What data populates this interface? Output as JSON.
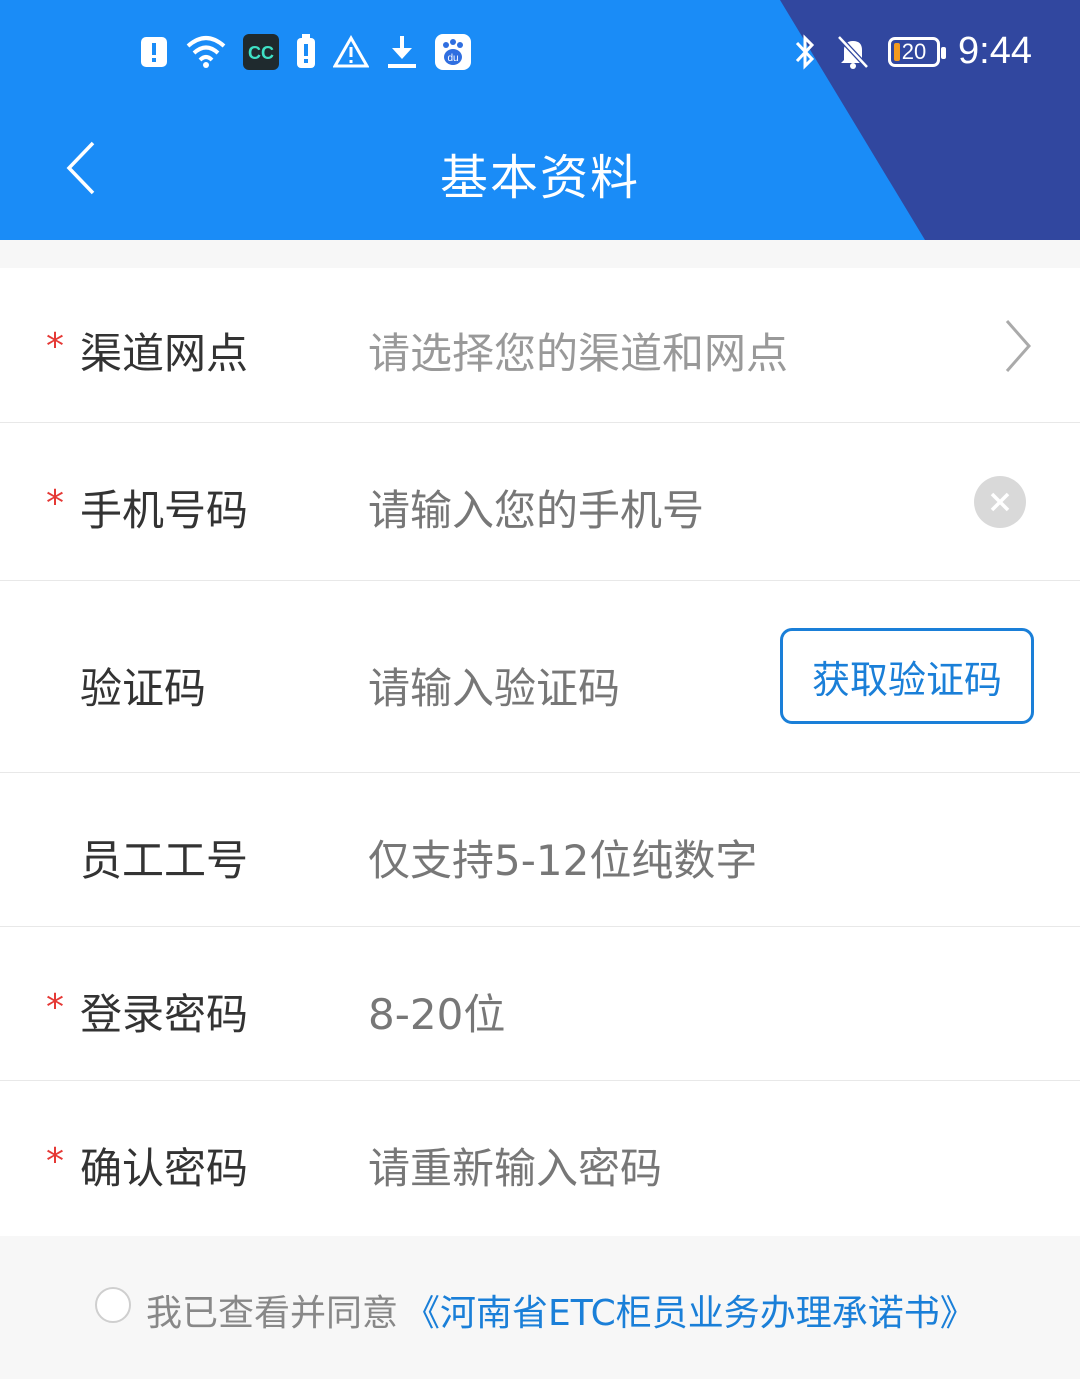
{
  "status_bar": {
    "time": "9:44",
    "battery": "20",
    "left_icons": [
      "alert-icon",
      "wifi-icon",
      "app-cc-icon",
      "sim-alert-icon",
      "warning-icon",
      "download-icon",
      "baidu-icon"
    ],
    "right_icons": [
      "bluetooth-icon",
      "mute-bell-icon",
      "battery-icon"
    ]
  },
  "header": {
    "title": "基本资料",
    "back_icon": "chevron-left-icon",
    "colors": {
      "primary": "#1a8cf7",
      "corner": "#31479f"
    }
  },
  "form": {
    "rows": [
      {
        "required": true,
        "label": "渠道网点",
        "value": "请选择您的渠道和网点",
        "trailing": "chevron-right-icon"
      },
      {
        "required": true,
        "label": "手机号码",
        "value": "请输入您的手机号",
        "trailing": "clear-icon"
      },
      {
        "required": false,
        "label": "验证码",
        "value": "请输入验证码",
        "trailing_button": "获取验证码"
      },
      {
        "required": false,
        "label": "员工工号",
        "value": "仅支持5-12位纯数字"
      },
      {
        "required": true,
        "label": "登录密码",
        "value": "8-20位"
      },
      {
        "required": true,
        "label": "确认密码",
        "value": "请重新输入密码"
      }
    ],
    "required_mark": "*"
  },
  "agreement": {
    "text": "我已查看并同意",
    "link": "《河南省ETC柜员业务办理承诺书》",
    "checked": false,
    "link_color": "#1a7fd8"
  }
}
